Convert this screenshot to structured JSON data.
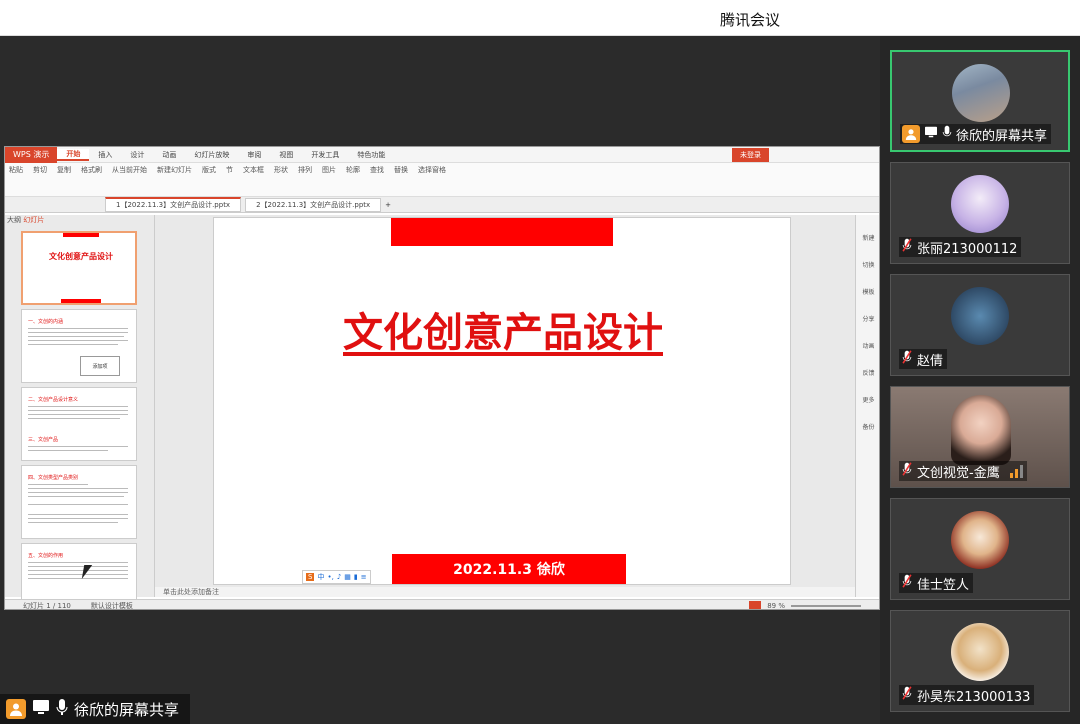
{
  "window": {
    "title": "腾讯会议"
  },
  "share_label": "徐欣的屏幕共享",
  "participants": [
    {
      "name": "徐欣的屏幕共享",
      "sharing": true
    },
    {
      "name": "张丽213000112"
    },
    {
      "name": "赵倩"
    },
    {
      "name": "文创视觉-金鹰"
    },
    {
      "name": "佳士笠人"
    },
    {
      "name": "孙昊东213000133"
    }
  ],
  "wps": {
    "brand": "WPS 演示",
    "menu": [
      "开始",
      "插入",
      "设计",
      "动画",
      "幻灯片放映",
      "审阅",
      "视图",
      "开发工具",
      "特色功能"
    ],
    "login": "未登录",
    "ribbon": [
      "粘贴",
      "剪切",
      "复制",
      "格式刷",
      "从当前开始",
      "新建幻灯片",
      "版式",
      "节",
      "文本框",
      "形状",
      "排列",
      "图片",
      "轮廓",
      "查找",
      "替换",
      "选择窗格"
    ],
    "tabs": [
      "1【2022.11.3】文创产品设计.pptx",
      "2【2022.11.3】文创产品设计.pptx"
    ],
    "panel_header_outline": "大纲",
    "panel_header_slides": "幻灯片",
    "slide": {
      "title": "文化创意产品设计",
      "date": "2022.11.3  徐欣"
    },
    "thumb1_title": "文化创意产品设计",
    "thumb_numbers": [
      "1",
      "2",
      "3",
      "4",
      "5"
    ],
    "thumb2_heading": "一、文创的内涵",
    "thumb3_heading": "二、文创产品设计意义",
    "thumb3_sub": "三、文创产品",
    "thumb4_heading": "四、文创类型产品类别",
    "thumb5_heading": "五、文创的作用",
    "thumb2_button": "添加项",
    "side_tools": [
      "新建",
      "切换",
      "模板",
      "分享",
      "动画",
      "反馈",
      "更多",
      "备份"
    ],
    "notes_hint": "单击此处添加备注",
    "status_page": "幻灯片 1 / 110",
    "status_theme": "默认设计模板",
    "zoom": "89 %"
  }
}
